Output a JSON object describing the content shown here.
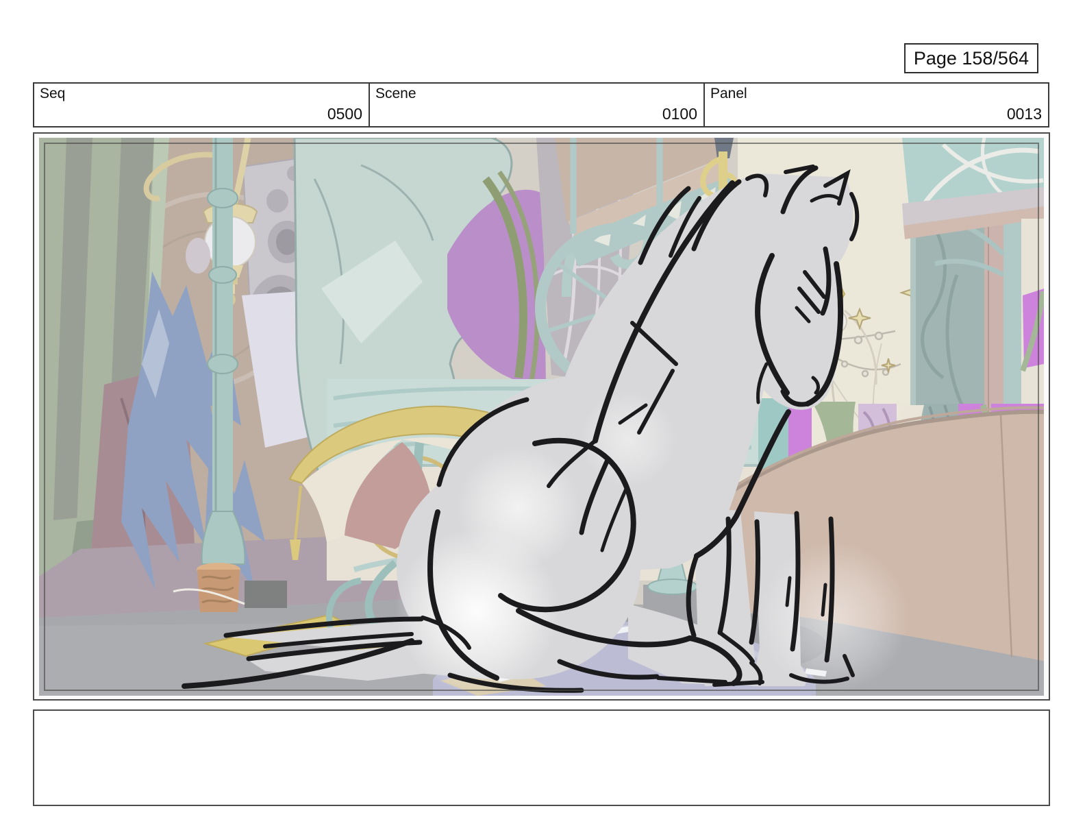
{
  "page": {
    "label": "Page 158/564"
  },
  "header": {
    "columns": [
      {
        "label": "Seq",
        "value": "0500"
      },
      {
        "label": "Scene",
        "value": "0100"
      },
      {
        "label": "Panel",
        "value": "0013"
      }
    ]
  },
  "panel_image": {
    "description": "Rough black brush sketch of a light gray horse sitting on its haunches, head lowered to the right, over a faded Art Nouveau carousel-hall background with teal ironwork columns, a giant pale-teal horse-head sculpture, hanging lamps, gold stars, magenta stained-glass panes, a saddle on an ornate stand, and a lavender domed ball on a gray floor."
  },
  "notes": {
    "text": ""
  },
  "colors": {
    "magenta_glass": "#c671d6",
    "pale_teal": "#aecbc7",
    "sage_green": "#9dab94",
    "tan_wall": "#c8af9f",
    "gold": "#d8c36a",
    "floor_gray": "#a0a1a6",
    "horse_fill": "#d8d8da",
    "sketch_ink": "#1b1b1e",
    "dome_lavender": "#b2b4ce"
  }
}
